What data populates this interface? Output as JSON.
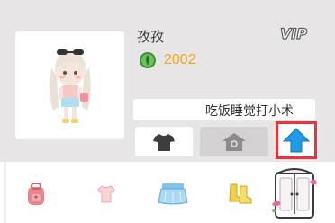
{
  "profile": {
    "username": "孜孜",
    "vip_label": "VIP",
    "coin_icon": "leaf-coin-icon",
    "coins": "2002",
    "motto": "吃饭睡觉打小术"
  },
  "tabs": [
    {
      "name": "clothes",
      "icon": "shirt-icon"
    },
    {
      "name": "house",
      "icon": "house-icon"
    }
  ],
  "upload_button": {
    "icon": "up-arrow-icon",
    "highlight_color": "#e8343a",
    "arrow_color": "#1e9be8"
  },
  "items": [
    {
      "icon": "backpack-icon"
    },
    {
      "icon": "top-icon"
    },
    {
      "icon": "skirt-icon"
    },
    {
      "icon": "boots-icon"
    },
    {
      "icon": "wardrobe-icon"
    }
  ]
}
